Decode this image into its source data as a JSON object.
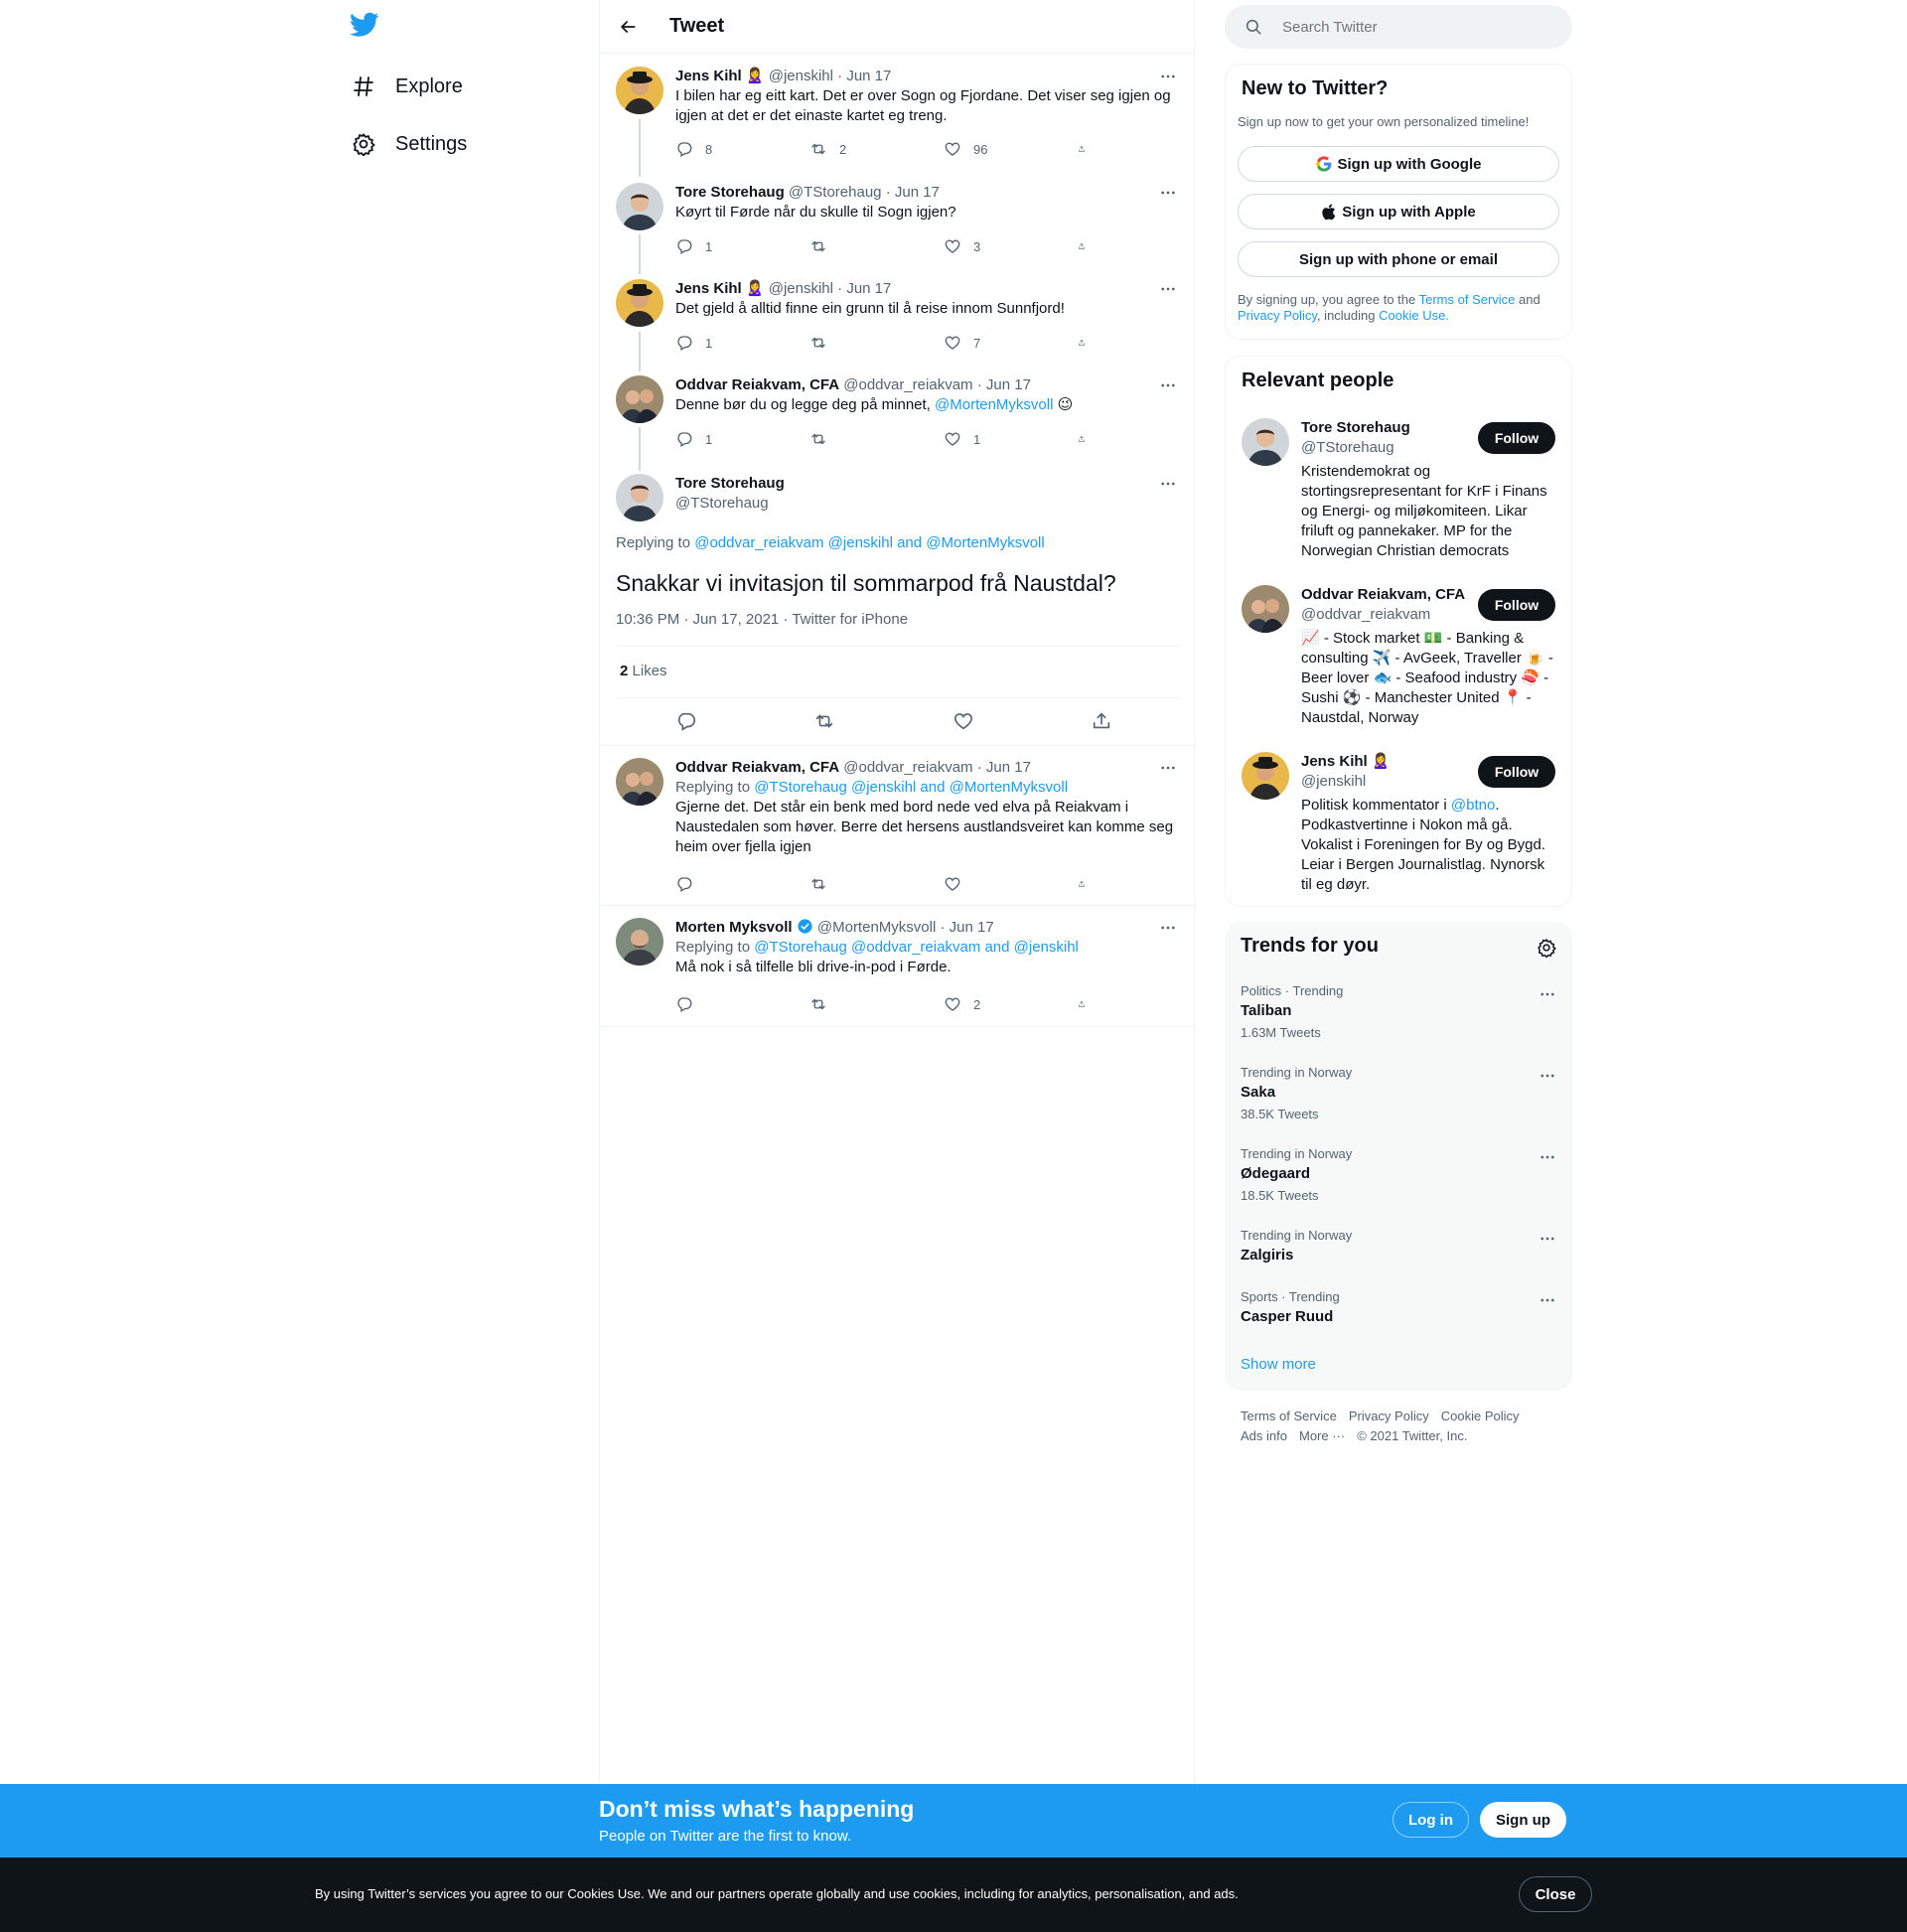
{
  "nav": {
    "explore": "Explore",
    "settings": "Settings"
  },
  "header": {
    "title": "Tweet"
  },
  "thread": [
    {
      "name": "Jens Kihl",
      "emoji": "🙎‍♀️",
      "handle": "@jenskihl",
      "date": "· Jun 17",
      "text": "I bilen har eg eitt kart. Det er over Sogn og Fjordane. Det viser seg igjen og igjen at det er det einaste kartet eg treng.",
      "replies": "8",
      "retweets": "2",
      "likes": "96"
    },
    {
      "name": "Tore Storehaug",
      "handle": "@TStorehaug",
      "date": "· Jun 17",
      "text": "Køyrt til Førde når du skulle til Sogn igjen?",
      "replies": "1",
      "retweets": "",
      "likes": "3"
    },
    {
      "name": "Jens Kihl",
      "emoji": "🙎‍♀️",
      "handle": "@jenskihl",
      "date": "· Jun 17",
      "text": "Det gjeld å alltid finne ein grunn til å reise innom Sunnfjord!",
      "replies": "1",
      "retweets": "",
      "likes": "7"
    },
    {
      "name": "Oddvar Reiakvam, CFA",
      "handle": "@oddvar_reiakvam",
      "date": "· Jun 17",
      "text_prefix": "Denne bør du og legge deg på minnet, ",
      "mention": "@MortenMyksvoll",
      "text_suffix": " 😉",
      "replies": "1",
      "retweets": "",
      "likes": "1"
    }
  ],
  "main_tweet": {
    "name": "Tore Storehaug",
    "handle": "@TStorehaug",
    "replying_label": "Replying to",
    "replying_to": "@oddvar_reiakvam @jenskihl and @MortenMyksvoll",
    "text": "Snakkar vi invitasjon til sommarpod frå Naustdal?",
    "timestamp": "10:36 PM · Jun 17, 2021 · Twitter for iPhone",
    "likes_count": "2",
    "likes_label": "Likes"
  },
  "replies": [
    {
      "name": "Oddvar Reiakvam, CFA",
      "handle": "@oddvar_reiakvam",
      "date": "· Jun 17",
      "replying_label": "Replying to",
      "replying_to": "@TStorehaug @jenskihl and @MortenMyksvoll",
      "text": "Gjerne det. Det står ein benk med bord nede ved elva på Reiakvam i Naustedalen som høver. Berre det hersens austlandsveiret kan komme seg heim over fjella igjen",
      "replies": "",
      "retweets": "",
      "likes": ""
    },
    {
      "name": "Morten Myksvoll",
      "handle": "@MortenMyksvoll",
      "date": "· Jun 17",
      "replying_label": "Replying to",
      "replying_to": "@TStorehaug @oddvar_reiakvam and @jenskihl",
      "text": "Må nok i så tilfelle bli drive-in-pod i Førde.",
      "replies": "",
      "retweets": "",
      "likes": "2"
    }
  ],
  "search": {
    "placeholder": "Search Twitter"
  },
  "new_to_twitter": {
    "title": "New to Twitter?",
    "subtitle": "Sign up now to get your own personalized timeline!",
    "google": "Sign up with Google",
    "apple": "Sign up with Apple",
    "phone": "Sign up with phone or email",
    "legal_1": "By signing up, you agree to the ",
    "terms": "Terms of Service",
    "legal_2": " and",
    "privacy": "Privacy Policy",
    "legal_3": ", including ",
    "cookie": "Cookie Use."
  },
  "relevant_people": {
    "title": "Relevant people",
    "follow_label": "Follow",
    "people": [
      {
        "name": "Tore Storehaug",
        "handle": "@TStorehaug",
        "bio": "Kristendemokrat og stortingsrepresentant for KrF i Finans og Energi- og miljøkomiteen. Likar friluft og pannekaker. MP for the Norwegian Christian democrats"
      },
      {
        "name": "Oddvar Reiakvam, CFA",
        "handle": "@oddvar_reiakvam",
        "bio": "📈 - Stock market 💵 - Banking & consulting ✈️ - AvGeek, Traveller 🍺 - Beer lover 🐟 - Seafood industry 🍣 - Sushi ⚽ - Manchester United 📍 - Naustdal, Norway"
      },
      {
        "name": "Jens Kihl",
        "emoji": "🙎‍♀️",
        "handle": "@jenskihl",
        "bio_prefix": "Politisk kommentator i ",
        "bio_mention": "@btno",
        "bio_suffix": ". Podkastvertinne i Nokon må gå. Vokalist i Foreningen for By og Bygd. Leiar i Bergen Journalistlag. Nynorsk til eg døyr."
      }
    ]
  },
  "trends": {
    "title": "Trends for you",
    "items": [
      {
        "context": "Politics · Trending",
        "name": "Taliban",
        "count": "1.63M Tweets"
      },
      {
        "context": "Trending in Norway",
        "name": "Saka",
        "count": "38.5K Tweets"
      },
      {
        "context": "Trending in Norway",
        "name": "Ødegaard",
        "count": "18.5K Tweets"
      },
      {
        "context": "Trending in Norway",
        "name": "Zalgiris",
        "count": ""
      },
      {
        "context": "Sports · Trending",
        "name": "Casper Ruud",
        "count": ""
      }
    ],
    "show_more": "Show more"
  },
  "footer": {
    "terms": "Terms of Service",
    "privacy": "Privacy Policy",
    "cookie": "Cookie Policy",
    "ads": "Ads info",
    "more": "More ···",
    "copyright": "© 2021 Twitter, Inc."
  },
  "bottom_bar": {
    "headline": "Don’t miss what’s happening",
    "sub": "People on Twitter are the first to know.",
    "login": "Log in",
    "signup": "Sign up"
  },
  "cookie_bar": {
    "text": "By using Twitter’s services you agree to our Cookies Use. We and our partners operate globally and use cookies, including for analytics, personalisation, and ads.",
    "close": "Close"
  },
  "colors": {
    "accent": "#1d9bf0",
    "text": "#0f1419",
    "muted": "#536471",
    "border": "#eff3f4",
    "cookie_bg": "#0f1419"
  }
}
